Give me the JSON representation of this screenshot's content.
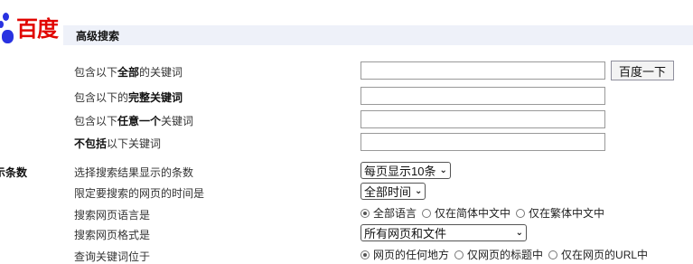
{
  "logo": {
    "text": "百度"
  },
  "header": {
    "title": "高级搜索"
  },
  "search_button": "百度一下",
  "keywords": {
    "all": {
      "prefix": "包含以下",
      "bold": "全部",
      "suffix": "的关键词",
      "value": ""
    },
    "exact": {
      "prefix": "包含以下的",
      "bold": "完整关键词",
      "suffix": "",
      "value": ""
    },
    "any": {
      "prefix": "包含以下",
      "bold": "任意一个",
      "suffix": "关键词",
      "value": ""
    },
    "none": {
      "prefix": "",
      "bold": "不包括",
      "suffix": "以下关键词",
      "value": ""
    }
  },
  "result_count": {
    "category": "示条数",
    "label": "选择搜索结果显示的条数",
    "selected": "每页显示10条"
  },
  "time": {
    "label": "限定要搜索的网页的时间是",
    "selected": "全部时间"
  },
  "language": {
    "label": "搜索网页语言是",
    "options": [
      "全部语言",
      "仅在简体中文中",
      "仅在繁体中文中"
    ],
    "selected_index": 0
  },
  "format": {
    "label": "搜索网页格式是",
    "selected": "所有网页和文件"
  },
  "position": {
    "label": "查询关键词位于",
    "options": [
      "网页的任何地方",
      "仅网页的标题中",
      "仅在网页的URL中"
    ],
    "selected_index": 0
  },
  "colors": {
    "logo_blue": "#2932e1",
    "logo_red": "#e10601",
    "header_bg": "#eef1f9"
  }
}
